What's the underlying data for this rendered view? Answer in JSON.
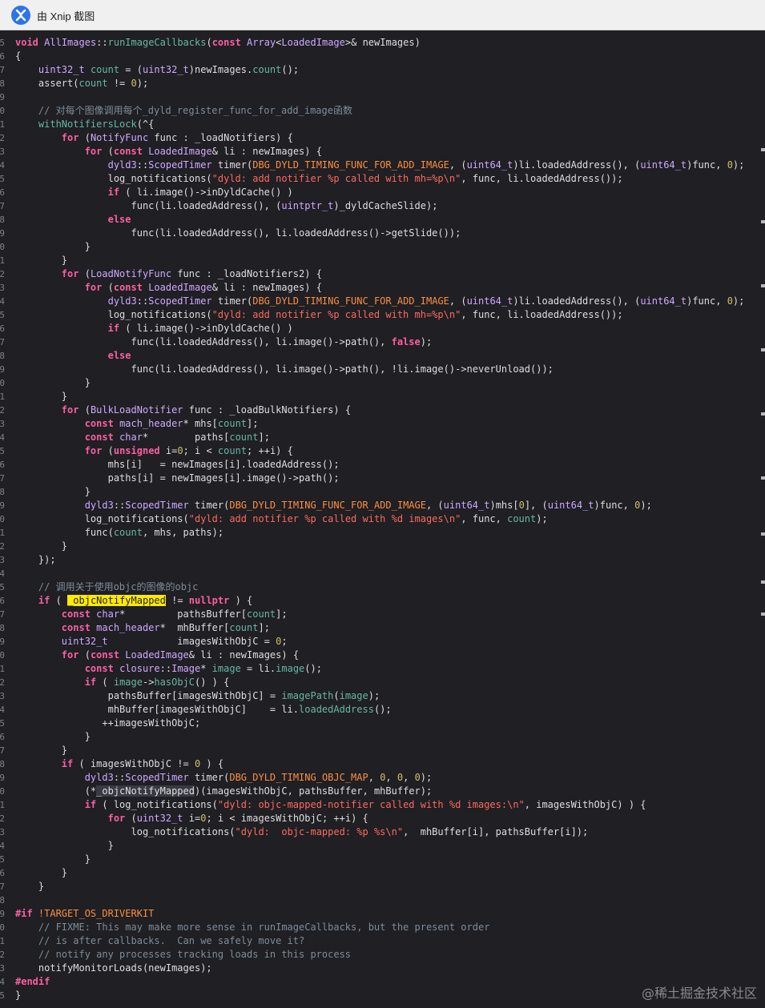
{
  "titlebar": {
    "title": "由 Xnip 截图",
    "icon": "xnip-app-icon"
  },
  "watermark": "@稀土掘金技术社区",
  "lines": [
    {
      "n": "5",
      "t": "void AllImages::runImageCallbacks(const Array<LoadedImage>& newImages)"
    },
    {
      "n": "6",
      "t": "{"
    },
    {
      "n": "7",
      "t": "    uint32_t count = (uint32_t)newImages.count();"
    },
    {
      "n": "8",
      "t": "    assert(count != 0);"
    },
    {
      "n": "9",
      "t": ""
    },
    {
      "n": "0",
      "t": "    // 对每个图像调用每个_dyld_register_func_for_add_image函数"
    },
    {
      "n": "1",
      "t": "    withNotifiersLock(^{"
    },
    {
      "n": "2",
      "t": "        for (NotifyFunc func : _loadNotifiers) {"
    },
    {
      "n": "3",
      "t": "            for (const LoadedImage& li : newImages) {"
    },
    {
      "n": "4",
      "t": "                dyld3::ScopedTimer timer(DBG_DYLD_TIMING_FUNC_FOR_ADD_IMAGE, (uint64_t)li.loadedAddress(), (uint64_t)func, 0);"
    },
    {
      "n": "5",
      "t": "                log_notifications(\"dyld: add notifier %p called with mh=%p\\n\", func, li.loadedAddress());"
    },
    {
      "n": "6",
      "t": "                if ( li.image()->inDyldCache() )"
    },
    {
      "n": "7",
      "t": "                    func(li.loadedAddress(), (uintptr_t)_dyldCacheSlide);"
    },
    {
      "n": "8",
      "t": "                else"
    },
    {
      "n": "9",
      "t": "                    func(li.loadedAddress(), li.loadedAddress()->getSlide());"
    },
    {
      "n": "0",
      "t": "            }"
    },
    {
      "n": "1",
      "t": "        }"
    },
    {
      "n": "2",
      "t": "        for (LoadNotifyFunc func : _loadNotifiers2) {"
    },
    {
      "n": "3",
      "t": "            for (const LoadedImage& li : newImages) {"
    },
    {
      "n": "4",
      "t": "                dyld3::ScopedTimer timer(DBG_DYLD_TIMING_FUNC_FOR_ADD_IMAGE, (uint64_t)li.loadedAddress(), (uint64_t)func, 0);"
    },
    {
      "n": "5",
      "t": "                log_notifications(\"dyld: add notifier %p called with mh=%p\\n\", func, li.loadedAddress());"
    },
    {
      "n": "6",
      "t": "                if ( li.image()->inDyldCache() )"
    },
    {
      "n": "7",
      "t": "                    func(li.loadedAddress(), li.image()->path(), false);"
    },
    {
      "n": "8",
      "t": "                else"
    },
    {
      "n": "9",
      "t": "                    func(li.loadedAddress(), li.image()->path(), !li.image()->neverUnload());"
    },
    {
      "n": "0",
      "t": "            }"
    },
    {
      "n": "1",
      "t": "        }"
    },
    {
      "n": "2",
      "t": "        for (BulkLoadNotifier func : _loadBulkNotifiers) {"
    },
    {
      "n": "3",
      "t": "            const mach_header* mhs[count];"
    },
    {
      "n": "4",
      "t": "            const char*        paths[count];"
    },
    {
      "n": "5",
      "t": "            for (unsigned i=0; i < count; ++i) {"
    },
    {
      "n": "6",
      "t": "                mhs[i]   = newImages[i].loadedAddress();"
    },
    {
      "n": "7",
      "t": "                paths[i] = newImages[i].image()->path();"
    },
    {
      "n": "8",
      "t": "            }"
    },
    {
      "n": "9",
      "t": "            dyld3::ScopedTimer timer(DBG_DYLD_TIMING_FUNC_FOR_ADD_IMAGE, (uint64_t)mhs[0], (uint64_t)func, 0);"
    },
    {
      "n": "0",
      "t": "            log_notifications(\"dyld: add notifier %p called with %d images\\n\", func, count);"
    },
    {
      "n": "1",
      "t": "            func(count, mhs, paths);"
    },
    {
      "n": "2",
      "t": "        }"
    },
    {
      "n": "3",
      "t": "    });"
    },
    {
      "n": "4",
      "t": ""
    },
    {
      "n": "5",
      "t": "    // 调用关于使用objc的图像的objc"
    },
    {
      "n": "6",
      "t": "    if ( _objcNotifyMapped != nullptr ) {"
    },
    {
      "n": "7",
      "t": "        const char*         pathsBuffer[count];"
    },
    {
      "n": "8",
      "t": "        const mach_header*  mhBuffer[count];"
    },
    {
      "n": "9",
      "t": "        uint32_t            imagesWithObjC = 0;"
    },
    {
      "n": "0",
      "t": "        for (const LoadedImage& li : newImages) {"
    },
    {
      "n": "1",
      "t": "            const closure::Image* image = li.image();"
    },
    {
      "n": "2",
      "t": "            if ( image->hasObjC() ) {"
    },
    {
      "n": "3",
      "t": "                pathsBuffer[imagesWithObjC] = imagePath(image);"
    },
    {
      "n": "4",
      "t": "                mhBuffer[imagesWithObjC]    = li.loadedAddress();"
    },
    {
      "n": "5",
      "t": "               ++imagesWithObjC;"
    },
    {
      "n": "6",
      "t": "            }"
    },
    {
      "n": "7",
      "t": "        }"
    },
    {
      "n": "8",
      "t": "        if ( imagesWithObjC != 0 ) {"
    },
    {
      "n": "9",
      "t": "            dyld3::ScopedTimer timer(DBG_DYLD_TIMING_OBJC_MAP, 0, 0, 0);"
    },
    {
      "n": "0",
      "t": "            (*_objcNotifyMapped)(imagesWithObjC, pathsBuffer, mhBuffer);"
    },
    {
      "n": "1",
      "t": "            if ( log_notifications(\"dyld: objc-mapped-notifier called with %d images:\\n\", imagesWithObjC) ) {"
    },
    {
      "n": "2",
      "t": "                for (uint32_t i=0; i < imagesWithObjC; ++i) {"
    },
    {
      "n": "3",
      "t": "                    log_notifications(\"dyld:  objc-mapped: %p %s\\n\",  mhBuffer[i], pathsBuffer[i]);"
    },
    {
      "n": "4",
      "t": "                }"
    },
    {
      "n": "5",
      "t": "            }"
    },
    {
      "n": "6",
      "t": "        }"
    },
    {
      "n": "7",
      "t": "    }"
    },
    {
      "n": "8",
      "t": ""
    },
    {
      "n": "9",
      "t": "#if !TARGET_OS_DRIVERKIT"
    },
    {
      "n": "0",
      "t": "    // FIXME: This may make more sense in runImageCallbacks, but the present order"
    },
    {
      "n": "1",
      "t": "    // is after callbacks.  Can we safely move it?"
    },
    {
      "n": "2",
      "t": "    // notify any processes tracking loads in this process"
    },
    {
      "n": "3",
      "t": "    notifyMonitorLoads(newImages);"
    },
    {
      "n": "4",
      "t": "#endif"
    },
    {
      "n": "5",
      "t": "}"
    }
  ]
}
